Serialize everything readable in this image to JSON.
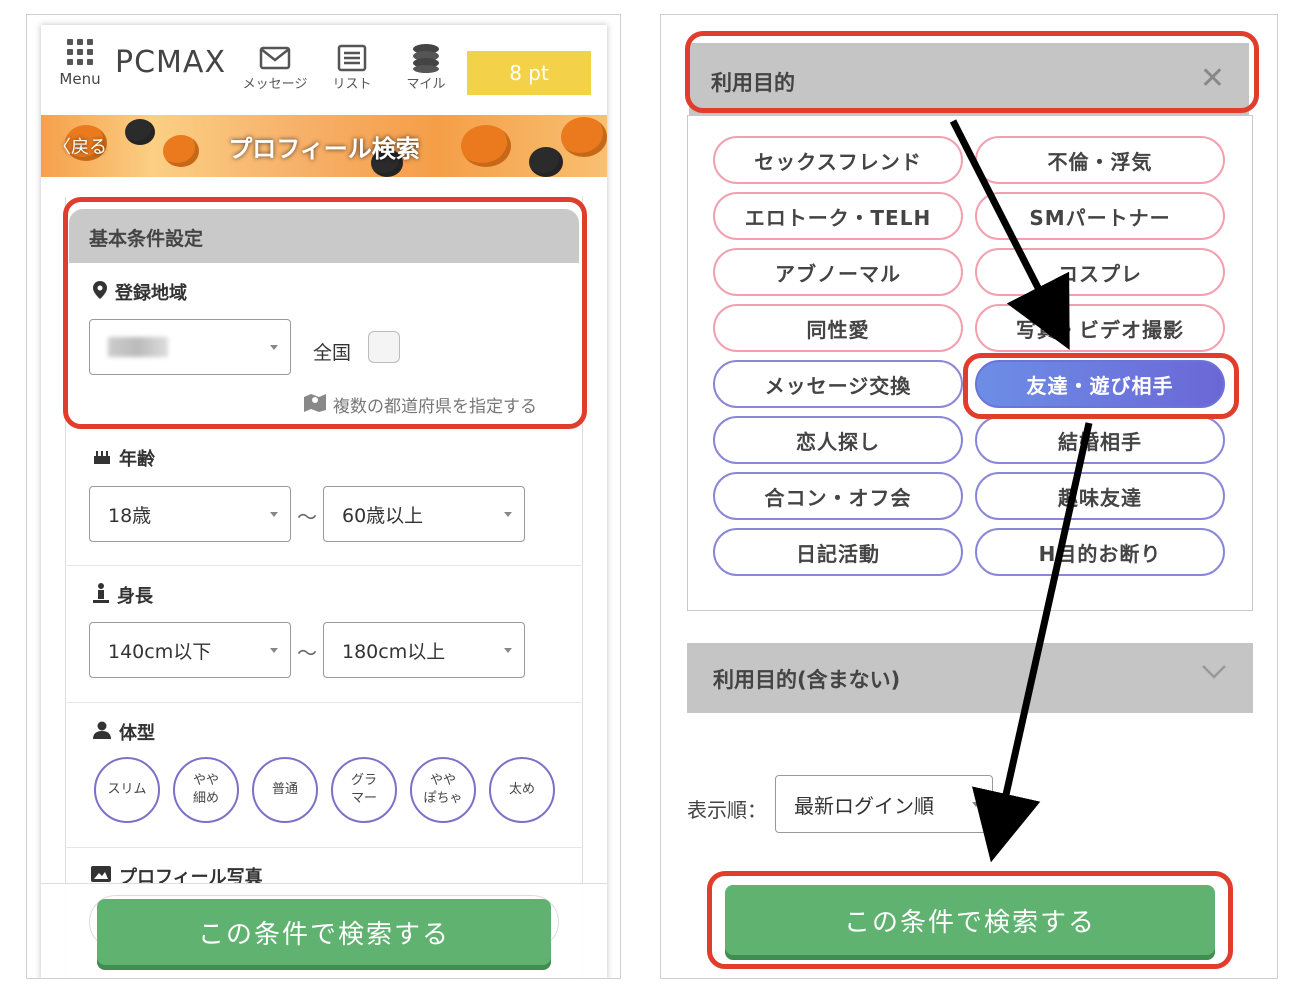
{
  "left": {
    "topbar": {
      "menu_label": "Menu",
      "logo": "PCMAX",
      "nav": [
        {
          "label": "メッセージ",
          "icon": "envelope-icon"
        },
        {
          "label": "リスト",
          "icon": "list-icon"
        },
        {
          "label": "マイル",
          "icon": "coins-icon"
        }
      ],
      "points": "8 pt",
      "points_color": "#f3d24a"
    },
    "banner": {
      "back": "戻る",
      "title": "プロフィール検索"
    },
    "basic": {
      "header": "基本条件設定",
      "region_label": "登録地域",
      "nationwide_label": "全国",
      "multi_link": "複数の都道府県を指定する"
    },
    "age": {
      "label": "年齢",
      "from": "18歳",
      "to": "60歳以上",
      "sep": "〜"
    },
    "height": {
      "label": "身長",
      "from": "140cm以下",
      "to": "180cm以上",
      "sep": "〜"
    },
    "body": {
      "label": "体型",
      "options": [
        "スリム",
        "やや\n細め",
        "普通",
        "グラ\nマー",
        "やや\nぽちゃ",
        "太め"
      ]
    },
    "photo_label": "プロフィール写真",
    "search_button": "この条件で検索する",
    "button_color": "#5fb26f"
  },
  "right": {
    "purpose_header": "利用目的",
    "close_icon": "✕",
    "tags": [
      {
        "label": "セックスフレンド",
        "style": "pink"
      },
      {
        "label": "不倫・浮気",
        "style": "pink"
      },
      {
        "label": "エロトーク・TELH",
        "style": "pink"
      },
      {
        "label": "SMパートナー",
        "style": "pink"
      },
      {
        "label": "アブノーマル",
        "style": "pink"
      },
      {
        "label": "コスプレ",
        "style": "pink"
      },
      {
        "label": "同性愛",
        "style": "pink"
      },
      {
        "label": "写真・ビデオ撮影",
        "style": "pink"
      },
      {
        "label": "メッセージ交換",
        "style": "purple"
      },
      {
        "label": "友達・遊び相手",
        "style": "selected"
      },
      {
        "label": "恋人探し",
        "style": "purple"
      },
      {
        "label": "結婚相手",
        "style": "purple"
      },
      {
        "label": "合コン・オフ会",
        "style": "purple"
      },
      {
        "label": "趣味友達",
        "style": "purple"
      },
      {
        "label": "日記活動",
        "style": "purple"
      },
      {
        "label": "H目的お断り",
        "style": "purple"
      }
    ],
    "exclude_header": "利用目的(含まない)",
    "sort_label": "表示順：",
    "sort_value": "最新ログイン順",
    "search_button": "この条件で検索する"
  },
  "highlight_color": "#e13d2c"
}
